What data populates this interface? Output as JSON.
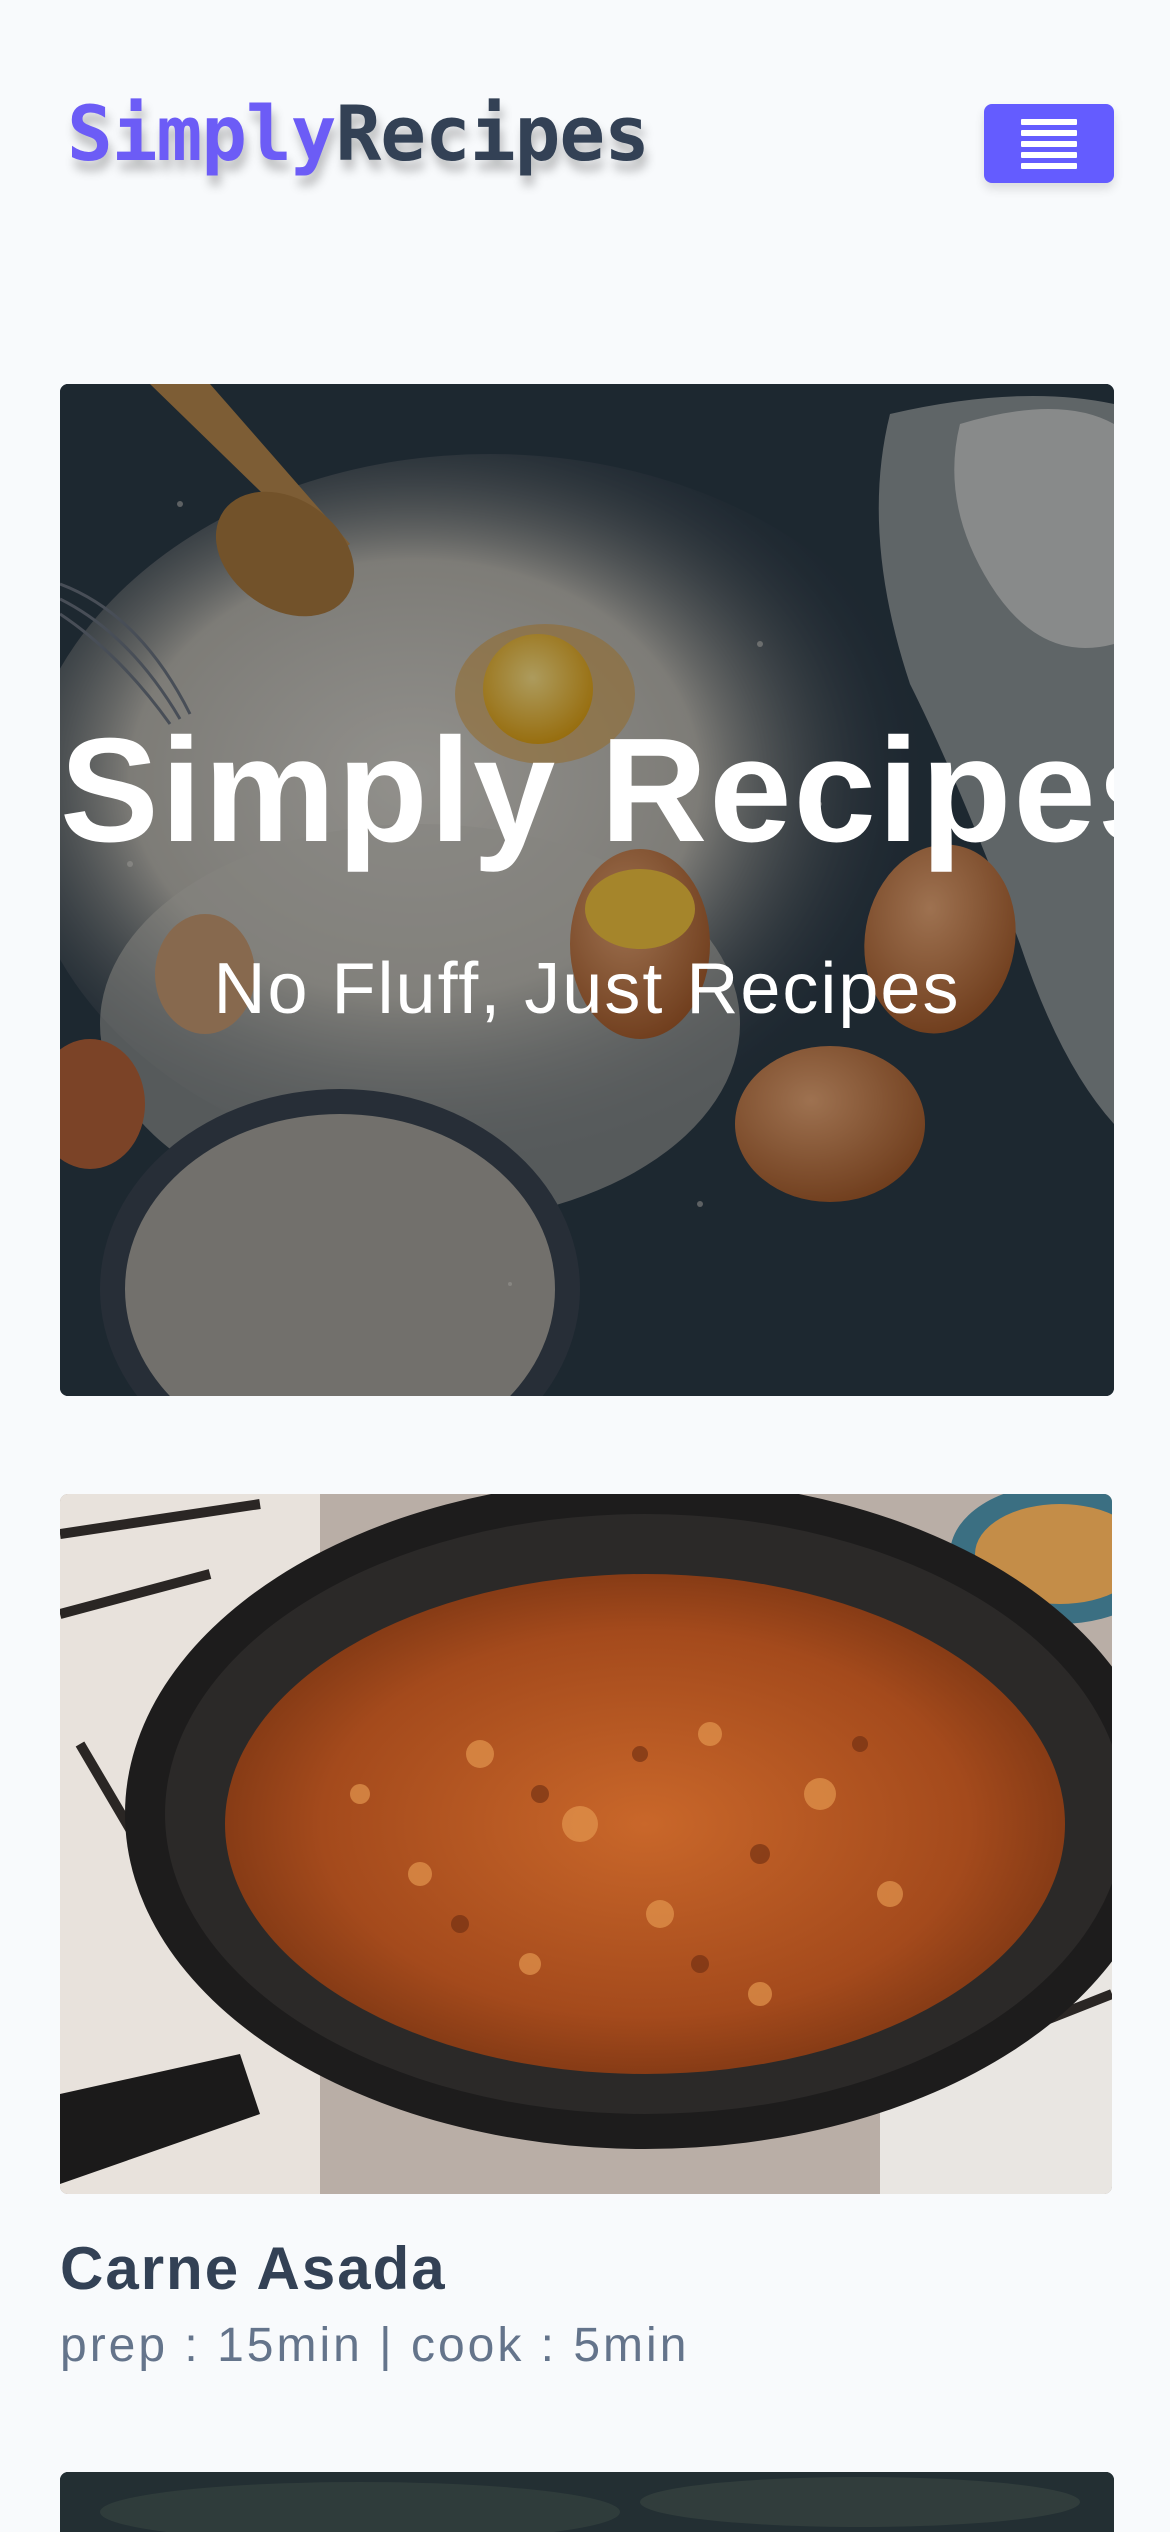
{
  "nav": {
    "logo_first": "Simply",
    "logo_second": "Recipes",
    "menu_icon": "hamburger-menu-icon",
    "accent_color": "#645cff"
  },
  "hero": {
    "title": "Simply Recipes",
    "subtitle": "No Fluff, Just Recipes",
    "image": "flour-eggs-whisk-photo"
  },
  "recipes": [
    {
      "title": "Carne Asada",
      "meta": "prep : 15min | cook : 5min",
      "image": "pan-fried-meat-photo"
    }
  ],
  "colors": {
    "page_bg": "#f8fafc",
    "heading_text": "#334155",
    "muted_text": "#64748b"
  }
}
